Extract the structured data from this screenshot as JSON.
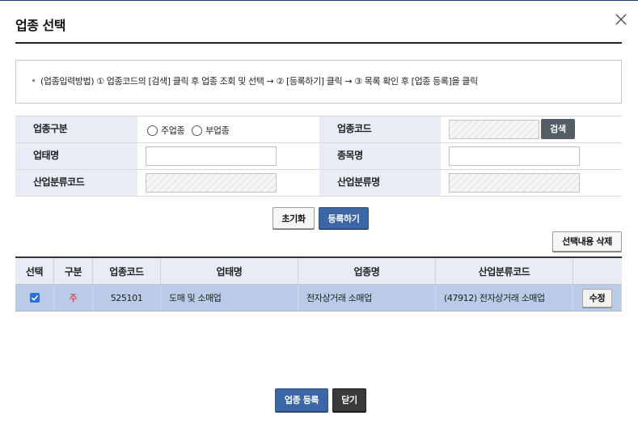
{
  "dialog": {
    "title": "업종 선택",
    "close_icon": "close-icon"
  },
  "guide": {
    "text": "(업종입력방법) ① 업종코드의 [검색] 클릭 후 업종 조회 및 선택 → ② [등록하기] 클릭 → ③ 목록 확인 후 [업종 등록]을 클릭"
  },
  "form": {
    "industry_type_label": "업종구분",
    "industry_type_options": [
      "주업종",
      "부업종"
    ],
    "industry_code_label": "업종코드",
    "search_label": "검색",
    "business_type_label": "업태명",
    "business_type_value": "",
    "item_name_label": "종목명",
    "item_name_value": "",
    "industry_class_code_label": "산업분류코드",
    "industry_class_name_label": "산업분류명"
  },
  "actions": {
    "reset_label": "초기화",
    "register_label": "등록하기",
    "delete_selected_label": "선택내용 삭제"
  },
  "grid": {
    "columns": [
      "선택",
      "구분",
      "업종코드",
      "업태명",
      "업종명",
      "산업분류코드",
      ""
    ],
    "rows": [
      {
        "checked": true,
        "type": "주",
        "code": "525101",
        "business_type": "도매 및 소매업",
        "industry_name": "전자상거래 소매업",
        "class_code": "(47912) 전자상거래 소매업",
        "edit_label": "수정"
      }
    ]
  },
  "footer": {
    "register_industry_label": "업종 등록",
    "close_label": "닫기"
  },
  "colors": {
    "header_bg": "#e8edf5",
    "selected_row_bg": "#b9cbe6",
    "primary_button": "#3b67a6",
    "dark_button": "#3a3a3a",
    "main_type_text": "#d62020"
  }
}
